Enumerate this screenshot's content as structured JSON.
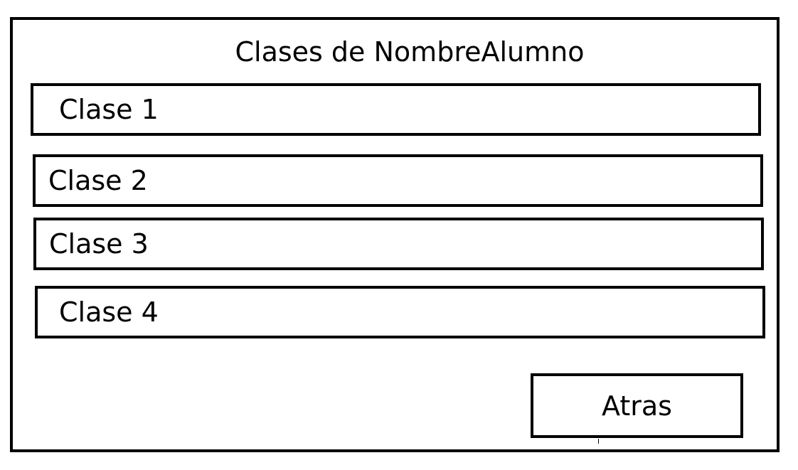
{
  "screen": {
    "title": "Clases de NombreAlumno"
  },
  "classes": [
    {
      "label": "Clase 1"
    },
    {
      "label": "Clase 2"
    },
    {
      "label": "Clase 3"
    },
    {
      "label": "Clase 4"
    }
  ],
  "actions": {
    "back_label": "Atras"
  },
  "colors": {
    "border": "#000000",
    "background": "#ffffff",
    "text": "#000000"
  }
}
